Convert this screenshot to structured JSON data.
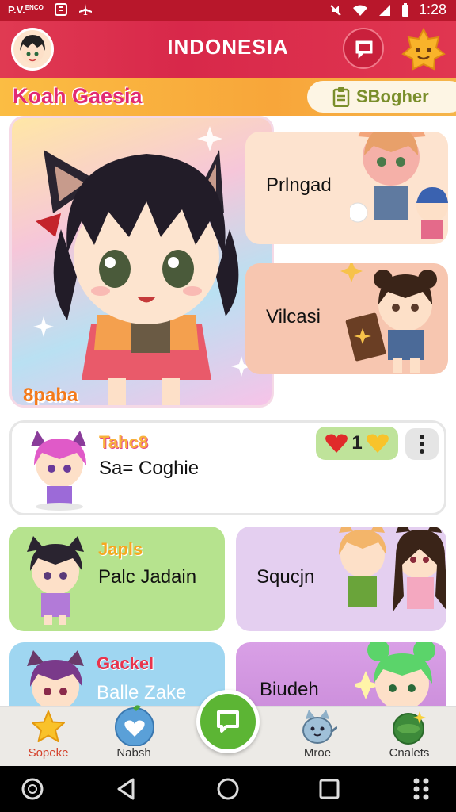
{
  "status_bar": {
    "carrier": "P.V.",
    "carrier_small": "ENCO",
    "time": "1:28",
    "icons": [
      "notification-icon",
      "airplane-icon",
      "mute-icon",
      "wifi-icon",
      "signal-icon",
      "battery-icon"
    ]
  },
  "header": {
    "title": "INDONESIA",
    "avatar": "user-avatar",
    "chat_icon": "chat-bubble-icon",
    "badge_icon": "star-badge-icon"
  },
  "banner": {
    "title": "Koah Gaesia",
    "pill_label": "SBogher",
    "pill_icon": "clipboard-icon"
  },
  "hero": {
    "tag": "8paba"
  },
  "side_cards": [
    {
      "label": "Prlngad"
    },
    {
      "label": "Vilcasi"
    }
  ],
  "post": {
    "tag": "Tahc8",
    "title": "Sa= Coghie",
    "like_count": "1"
  },
  "grid": [
    {
      "tag": "Japls",
      "label": "Palc Jadain",
      "color": "#b6e38e"
    },
    {
      "label": "Squcjn",
      "color": "#e4cff0"
    },
    {
      "tag": "Gackel",
      "label": "Balle Zake",
      "color": "#9fd6f1"
    },
    {
      "label": "Biudeh",
      "color": "#d9a0e6"
    }
  ],
  "bottom_nav": [
    {
      "label": "Sopeke",
      "icon": "star-icon"
    },
    {
      "label": "Nabsh",
      "icon": "heart-icon"
    },
    {
      "label": "Mroe",
      "icon": "mascot-icon"
    },
    {
      "label": "Cnalets",
      "icon": "planet-icon"
    }
  ],
  "fab": {
    "icon": "chat-bubble-icon"
  },
  "colors": {
    "header": "#d8284a",
    "banner": "#f8a63a",
    "accent_green": "#5cb534",
    "tag_orange": "#f47a1a",
    "banner_title": "#e22a73"
  }
}
